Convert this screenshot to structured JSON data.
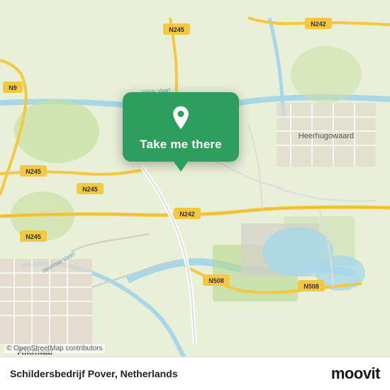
{
  "map": {
    "attribution": "© OpenStreetMap contributors",
    "location": "Schildersbedrijf Pover, Netherlands"
  },
  "popup": {
    "label": "Take me there",
    "icon": "location-pin"
  },
  "branding": {
    "logo": "moovit"
  },
  "roads": [
    {
      "label": "N242"
    },
    {
      "label": "N245"
    },
    {
      "label": "N508"
    },
    {
      "label": "N9"
    },
    {
      "label": "Hoornse Vaart"
    },
    {
      "label": "Wijde Vaart"
    }
  ]
}
